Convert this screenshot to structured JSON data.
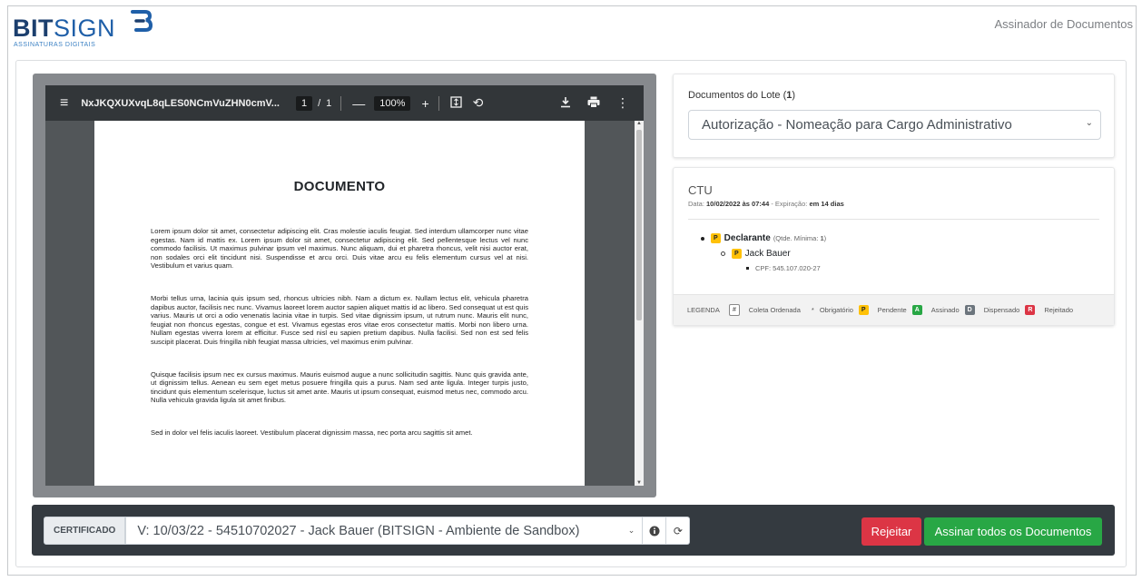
{
  "header": {
    "logo_main_bold": "BIT",
    "logo_main_light": "SIGN",
    "logo_sub": "ASSINATURAS DIGITAIS",
    "title": "Assinador de Documentos"
  },
  "pdf_viewer": {
    "filename": "NxJKQXUXvqL8qLES0NCmVuZHN0cmV...",
    "page_current": "1",
    "page_sep": "/",
    "page_total": "1",
    "zoom_out": "—",
    "zoom": "100%",
    "zoom_in": "+",
    "icons": {
      "menu": "menu-icon",
      "fit": "fit-page-icon",
      "rotate": "rotate-icon",
      "download": "download-icon",
      "print": "print-icon",
      "more": "more-icon"
    },
    "document": {
      "title": "DOCUMENTO",
      "paragraphs": [
        "Lorem ipsum dolor sit amet, consectetur adipiscing elit. Cras molestie iaculis feugiat. Sed interdum ullamcorper nunc vitae egestas. Nam id mattis ex. Lorem ipsum dolor sit amet, consectetur adipiscing elit. Sed pellentesque lectus vel nunc commodo facilisis. Ut maximus pulvinar ipsum vel maximus. Nunc aliquam, dui et pharetra rhoncus, velit nisi auctor erat, non sodales orci elit tincidunt nisi. Suspendisse et arcu orci. Duis vitae arcu eu felis elementum cursus vel at nisi. Vestibulum et varius quam.",
        "Morbi tellus urna, lacinia quis ipsum sed, rhoncus ultricies nibh. Nam a dictum ex. Nullam lectus elit, vehicula pharetra dapibus auctor, facilisis nec nunc. Vivamus laoreet lorem auctor sapien aliquet mattis id ac libero. Sed consequat ut est quis varius. Mauris ut orci a odio venenatis lacinia vitae in turpis. Sed vitae dignissim ipsum, ut rutrum nunc. Mauris elit nunc, feugiat non rhoncus egestas, congue et est. Vivamus egestas eros vitae eros consectetur mattis. Morbi non libero urna. Nullam egestas viverra lorem at efficitur. Fusce sed nisl eu sapien pretium dapibus. Nulla facilisi. Sed non est sed felis suscipit placerat. Duis fringilla nibh feugiat massa ultricies, vel maximus enim pulvinar.",
        "Quisque facilisis ipsum nec ex cursus maximus. Mauris euismod augue a nunc sollicitudin sagittis. Nunc quis gravida ante, ut dignissim tellus. Aenean eu sem eget metus posuere fringilla quis a purus. Nam sed ante ligula. Integer turpis justo, tincidunt quis elementum scelerisque, luctus sit amet ante. Mauris ut ipsum consequat, euismod metus nec, commodo arcu. Nulla vehicula gravida ligula sit amet finibus.",
        "Sed in dolor vel felis iaculis laoreet. Vestibulum placerat dignissim massa, nec porta arcu sagittis sit amet."
      ]
    }
  },
  "docs_card": {
    "label_prefix": "Documentos do Lote (",
    "count": "1",
    "label_suffix": ")",
    "selected": "Autorização - Nomeação para Cargo Administrativo"
  },
  "ctu_card": {
    "title": "CTU",
    "date_label": "Data: ",
    "date_value": "10/02/2022 às 07:44",
    "expire_label": " - Expiração: ",
    "expire_value": "em 14 dias",
    "role_badge": "P",
    "role": "Declarante",
    "role_min_prefix": "(Qtde. Mínima: ",
    "role_min": "1",
    "role_min_suffix": ")",
    "signer_badge": "P",
    "signer": "Jack Bauer",
    "cpf": "CPF: 545.107.020-27"
  },
  "legend": {
    "title": "LEGENDA",
    "ordered_badge": "#",
    "ordered": "Coleta Ordenada",
    "required_mark": "*",
    "required": "Obrigatório",
    "pending_badge": "P",
    "pending": "Pendente",
    "signed_badge": "A",
    "signed": "Assinado",
    "waived_badge": "D",
    "waived": "Dispensado",
    "rejected_badge": "R",
    "rejected": "Rejeitado"
  },
  "bottom_bar": {
    "cert_label": "CERTIFICADO",
    "cert_selected": "V: 10/03/22 - 54510702027 - Jack Bauer (BITSIGN - Ambiente de Sandbox)",
    "reject": "Rejeitar",
    "sign_all": "Assinar todos os Documentos"
  },
  "colors": {
    "brand_dark": "#1c3f6e",
    "brand_blue": "#1f5fa8",
    "danger": "#dc3545",
    "success": "#28a745",
    "warning": "#ffc107",
    "secondary": "#6c757d",
    "dark_bar": "#343a40"
  }
}
